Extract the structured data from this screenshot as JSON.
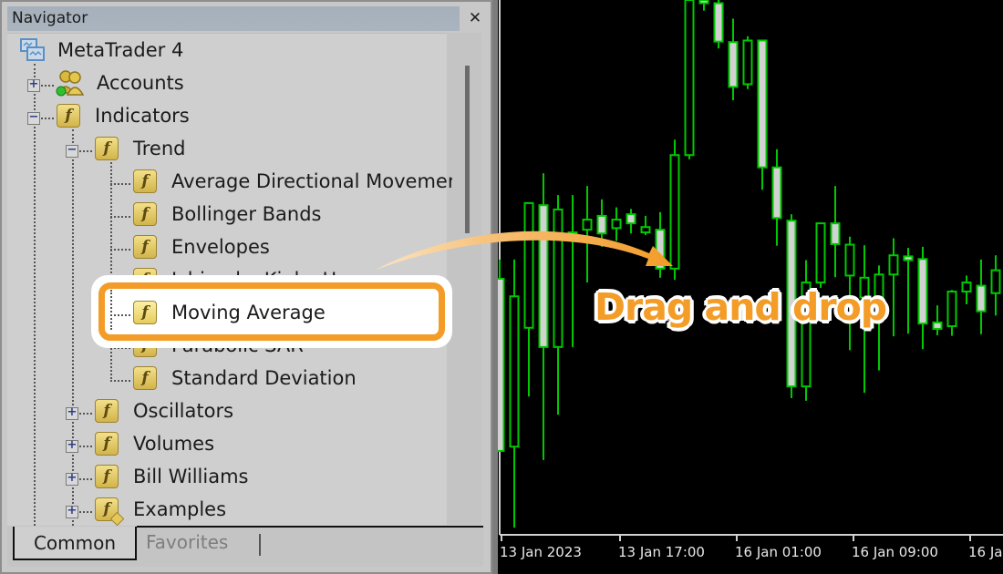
{
  "navigator": {
    "title": "Navigator",
    "close_icon": "close-icon",
    "tree": {
      "root": {
        "label": "MetaTrader 4",
        "icon": "terminal-icon"
      },
      "accounts": {
        "label": "Accounts",
        "icon": "accounts-icon",
        "expanded": false
      },
      "indicators": {
        "label": "Indicators",
        "icon": "function-icon",
        "expanded": true
      },
      "trend": {
        "label": "Trend",
        "icon": "function-icon",
        "expanded": true
      },
      "trend_items": [
        {
          "label": "Average Directional Movemer",
          "icon": "function-icon"
        },
        {
          "label": "Bollinger Bands",
          "icon": "function-icon"
        },
        {
          "label": "Envelopes",
          "icon": "function-icon"
        },
        {
          "label": "Ichimoku Kinko Hyo",
          "icon": "function-icon"
        },
        {
          "label": "Moving Average",
          "icon": "function-icon",
          "highlighted": true
        },
        {
          "label": "Parabolic SAR",
          "icon": "function-icon"
        },
        {
          "label": "Standard Deviation",
          "icon": "function-icon"
        }
      ],
      "groups": [
        {
          "label": "Oscillators",
          "icon": "function-icon",
          "expanded": false
        },
        {
          "label": "Volumes",
          "icon": "function-icon",
          "expanded": false
        },
        {
          "label": "Bill Williams",
          "icon": "function-icon",
          "expanded": false
        },
        {
          "label": "Examples",
          "icon": "function-example-icon",
          "expanded": false
        }
      ]
    },
    "tabs": [
      {
        "label": "Common",
        "active": true
      },
      {
        "label": "Favorites",
        "active": false
      }
    ]
  },
  "annotation": {
    "text": "Drag and drop",
    "color": "#f39c27"
  },
  "chart_data": {
    "type": "candlestick",
    "title": "",
    "xlabel": "",
    "ylabel": "",
    "x_tick_labels": [
      "13 Jan 2023",
      "13 Jan 17:00",
      "16 Jan 01:00",
      "16 Jan 09:00",
      "16 Ja"
    ],
    "y_units": "relative price (0 = bottom of visible area, 100 = top)",
    "ylim": [
      0,
      100
    ],
    "grid": false,
    "colors": {
      "background": "#000000",
      "candle_outline": "#00c800",
      "bull_body": "#000000",
      "bear_body": "#d2d2d2"
    },
    "candles": [
      {
        "o": 47.7,
        "h": 51.3,
        "l": 15.7,
        "c": 15.4,
        "bear": true
      },
      {
        "o": 16.2,
        "h": 51.3,
        "l": 1.0,
        "c": 44.4,
        "bull": true
      },
      {
        "o": 38.5,
        "h": 59.8,
        "l": 25.6,
        "c": 61.9,
        "bull": true
      },
      {
        "o": 61.5,
        "h": 67.5,
        "l": 13.7,
        "c": 34.9,
        "bear": true
      },
      {
        "o": 34.9,
        "h": 63.4,
        "l": 22.2,
        "c": 60.7,
        "bull": true
      },
      {
        "o": 56.4,
        "h": 63.4,
        "l": 34.9,
        "c": 56.4,
        "bull": true
      },
      {
        "o": 56.9,
        "h": 65.1,
        "l": 47.0,
        "c": 58.8,
        "bull": true
      },
      {
        "o": 59.5,
        "h": 62.6,
        "l": 53.7,
        "c": 56.2,
        "bear": true
      },
      {
        "o": 57.2,
        "h": 61.1,
        "l": 54.8,
        "c": 58.8,
        "bull": true
      },
      {
        "o": 59.8,
        "h": 60.8,
        "l": 56.2,
        "c": 58.1,
        "bear": true
      },
      {
        "o": 56.4,
        "h": 59.5,
        "l": 55.9,
        "c": 57.4,
        "bull": true
      },
      {
        "o": 56.9,
        "h": 60.2,
        "l": 47.9,
        "c": 49.6,
        "bear": true
      },
      {
        "o": 49.6,
        "h": 73.8,
        "l": 47.5,
        "c": 70.9,
        "bull": true
      },
      {
        "o": 70.9,
        "h": 100.0,
        "l": 70.1,
        "c": 100.0,
        "bull": true
      },
      {
        "o": 100.0,
        "h": 100.0,
        "l": 98.0,
        "c": 99.4,
        "bear": true
      },
      {
        "o": 99.4,
        "h": 100.0,
        "l": 90.9,
        "c": 92.2,
        "bear": true
      },
      {
        "o": 92.1,
        "h": 96.5,
        "l": 81.2,
        "c": 83.7,
        "bear": true
      },
      {
        "o": 84.2,
        "h": 93.2,
        "l": 83.3,
        "c": 92.4,
        "bull": true
      },
      {
        "o": 92.4,
        "h": 92.4,
        "l": 64.4,
        "c": 68.6,
        "bear": true
      },
      {
        "o": 68.6,
        "h": 72.0,
        "l": 53.9,
        "c": 59.1,
        "bear": true
      },
      {
        "o": 58.6,
        "h": 59.8,
        "l": 25.3,
        "c": 27.5,
        "bear": true
      },
      {
        "o": 27.5,
        "h": 51.2,
        "l": 24.8,
        "c": 47.0,
        "bull": true
      },
      {
        "o": 47.0,
        "h": 58.1,
        "l": 46.0,
        "c": 58.1,
        "bull": true
      },
      {
        "o": 58.1,
        "h": 65.1,
        "l": 48.0,
        "c": 54.2,
        "bear": true
      },
      {
        "o": 54.1,
        "h": 55.6,
        "l": 34.3,
        "c": 48.3,
        "bull": true
      },
      {
        "o": 47.9,
        "h": 54.0,
        "l": 26.3,
        "c": 44.2,
        "bull": true
      },
      {
        "o": 43.9,
        "h": 50.2,
        "l": 30.5,
        "c": 48.5,
        "bull": true
      },
      {
        "o": 48.5,
        "h": 55.3,
        "l": 36.9,
        "c": 52.1,
        "bull": true
      },
      {
        "o": 51.9,
        "h": 53.5,
        "l": 37.4,
        "c": 51.2,
        "bear": true
      },
      {
        "o": 51.4,
        "h": 53.7,
        "l": 34.5,
        "c": 39.3,
        "bear": true
      },
      {
        "o": 39.5,
        "h": 42.7,
        "l": 37.1,
        "c": 38.3,
        "bear": true
      },
      {
        "o": 38.8,
        "h": 45.6,
        "l": 37.0,
        "c": 45.3,
        "bull": true
      },
      {
        "o": 45.3,
        "h": 48.3,
        "l": 42.9,
        "c": 47.0,
        "bull": true
      },
      {
        "o": 41.6,
        "h": 51.3,
        "l": 37.3,
        "c": 46.4,
        "bear": true
      },
      {
        "o": 45.0,
        "h": 52.1,
        "l": 40.8,
        "c": 49.3,
        "bull": true
      },
      {
        "o": 49.6,
        "h": 60.8,
        "l": 40.6,
        "c": 58.6,
        "bull": true
      }
    ]
  }
}
